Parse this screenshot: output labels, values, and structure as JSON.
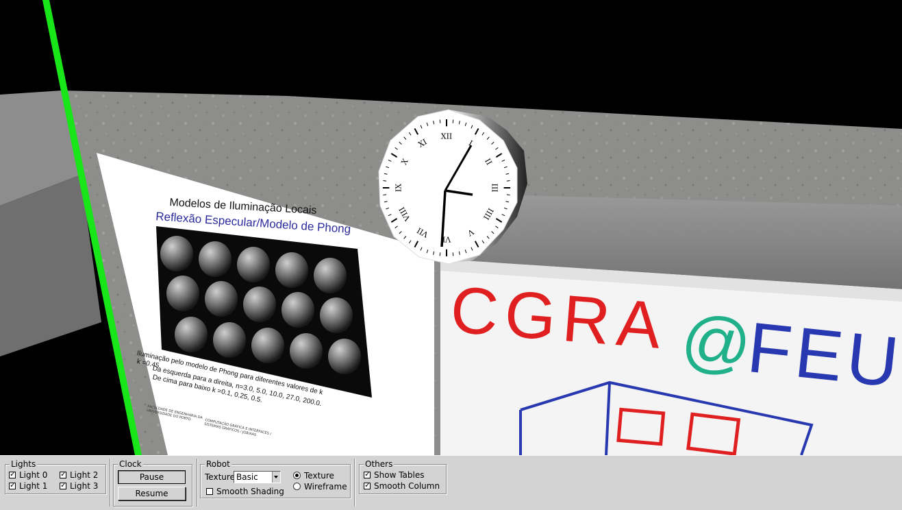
{
  "poster": {
    "title": "Modelos de Iluminação Locais",
    "subtitle": "Reflexão Especular/Modelo de Phong",
    "caption_line1": "Iluminação pelo modelo de Phong para diferentes valores de k",
    "caption_line2": "k =0.45.",
    "caption_line3": "Da esquerda para a direita, n=3.0, 5.0, 10.0, 27.0, 200.0.",
    "caption_line4": "De cima para baixo k =0.1, 0.25, 0.5.",
    "footer_left": "FACULDADE DE ENGENHARIA DA UNIVERSIDADE DO PORTO",
    "footer_right": "COMPUTAÇÃO GRÁFICA E INTERFACES / SISTEMAS GRÁFICOS / JGB/AAS"
  },
  "whiteboard": {
    "text_cgra": "CGRA",
    "text_at": "@",
    "text_feu": "FEU"
  },
  "clock_face": {
    "numerals": [
      "XII",
      "I",
      "II",
      "III",
      "IIII",
      "V",
      "VI",
      "VII",
      "VIII",
      "IX",
      "X",
      "XI"
    ]
  },
  "panel": {
    "lights": {
      "title": "Lights",
      "light0": "Light 0",
      "light1": "Light 1",
      "light2": "Light 2",
      "light3": "Light 3"
    },
    "clock": {
      "title": "Clock",
      "pause": "Pause",
      "resume": "Resume"
    },
    "robot": {
      "title": "Robot",
      "texture_label": "Texture",
      "texture_value": "Basic",
      "smooth_shading": "Smooth Shading",
      "radio_texture": "Texture",
      "radio_wireframe": "Wireframe"
    },
    "others": {
      "title": "Others",
      "show_tables": "Show Tables",
      "smooth_column": "Smooth Column"
    }
  },
  "colors": {
    "green_axis": "#19e619",
    "wall": "#8e8e8c",
    "panel_bg": "#d3d3d3",
    "poster_blue": "#2b2b9e",
    "marker_red": "#e02020",
    "marker_teal": "#20b08a",
    "marker_blue": "#2838b0"
  }
}
